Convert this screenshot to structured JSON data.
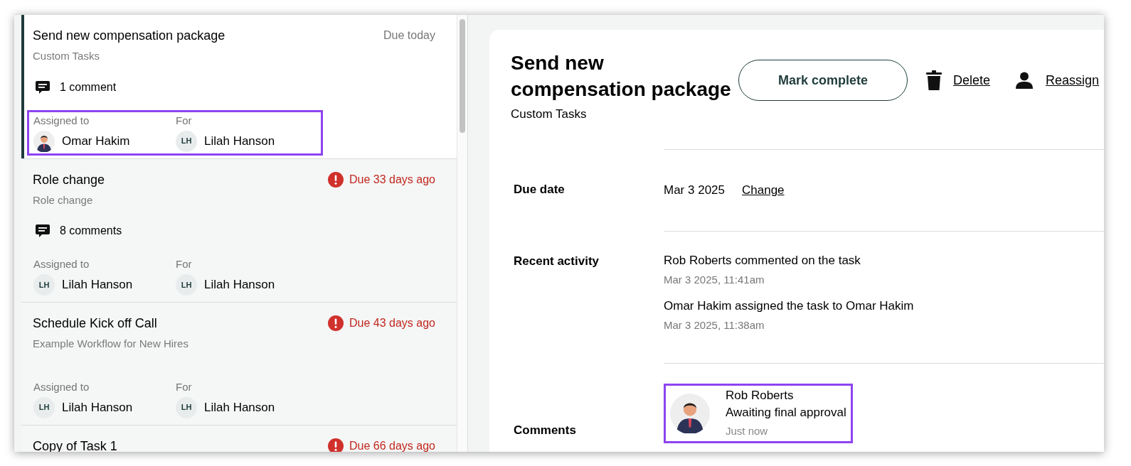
{
  "task_list": [
    {
      "title": "Send new compensation package",
      "workflow": "Custom Tasks",
      "due": "Due today",
      "overdue": false,
      "selected": true,
      "comments": "1 comment",
      "assigned_label": "Assigned to",
      "assignee": {
        "name": "Omar Hakim"
      },
      "for_label": "For",
      "for": {
        "name": "Lilah Hanson",
        "avatar": {
          "kind": "initials",
          "initials": "LH"
        }
      },
      "highlighted": true
    },
    {
      "title": "Role change",
      "workflow": "Role change",
      "due": "Due 33 days ago",
      "overdue": true,
      "selected": false,
      "comments": "8 comments",
      "assigned_label": "Assigned to",
      "assignee": {
        "name": "Lilah Hanson",
        "avatar": {
          "kind": "initials",
          "initials": "LH"
        }
      },
      "for_label": "For",
      "for": {
        "name": "Lilah Hanson",
        "avatar": {
          "kind": "initials",
          "initials": "LH"
        }
      },
      "highlighted": false
    },
    {
      "title": "Schedule Kick off Call",
      "workflow": "Example Workflow for New Hires",
      "due": "Due 43 days ago",
      "overdue": true,
      "selected": false,
      "assigned_label": "Assigned to",
      "assignee": {
        "name": "Lilah Hanson",
        "avatar": {
          "kind": "initials",
          "initials": "LH"
        }
      },
      "for_label": "For",
      "for": {
        "name": "Lilah Hanson",
        "avatar": {
          "kind": "initials",
          "initials": "LH"
        }
      },
      "highlighted": false
    },
    {
      "title": "Copy of Task 1",
      "due": "Due 66 days ago",
      "overdue": true,
      "selected": false
    }
  ],
  "detail": {
    "title": "Send new compensation package",
    "workflow": "Custom Tasks",
    "actions": [
      {
        "kind": "primary",
        "label": "Mark complete"
      },
      {
        "kind": "delete",
        "label": "Delete"
      },
      {
        "kind": "reassign",
        "label": "Reassign"
      }
    ],
    "due_date": {
      "label": "Due date",
      "value": "Mar 3 2025",
      "action": "Change"
    },
    "recent_activity": {
      "label": "Recent activity",
      "items": [
        {
          "text": "Rob Roberts commented on the task",
          "time": "Mar 3 2025, 11:41am"
        },
        {
          "text": "Omar Hakim assigned the task to Omar Hakim",
          "time": "Mar 3 2025, 11:38am"
        }
      ]
    },
    "comments": {
      "label": "Comments",
      "items": [
        {
          "author": "Rob Roberts",
          "text": "Awaiting final approval",
          "time": "Just now",
          "highlighted": true
        }
      ]
    }
  }
}
